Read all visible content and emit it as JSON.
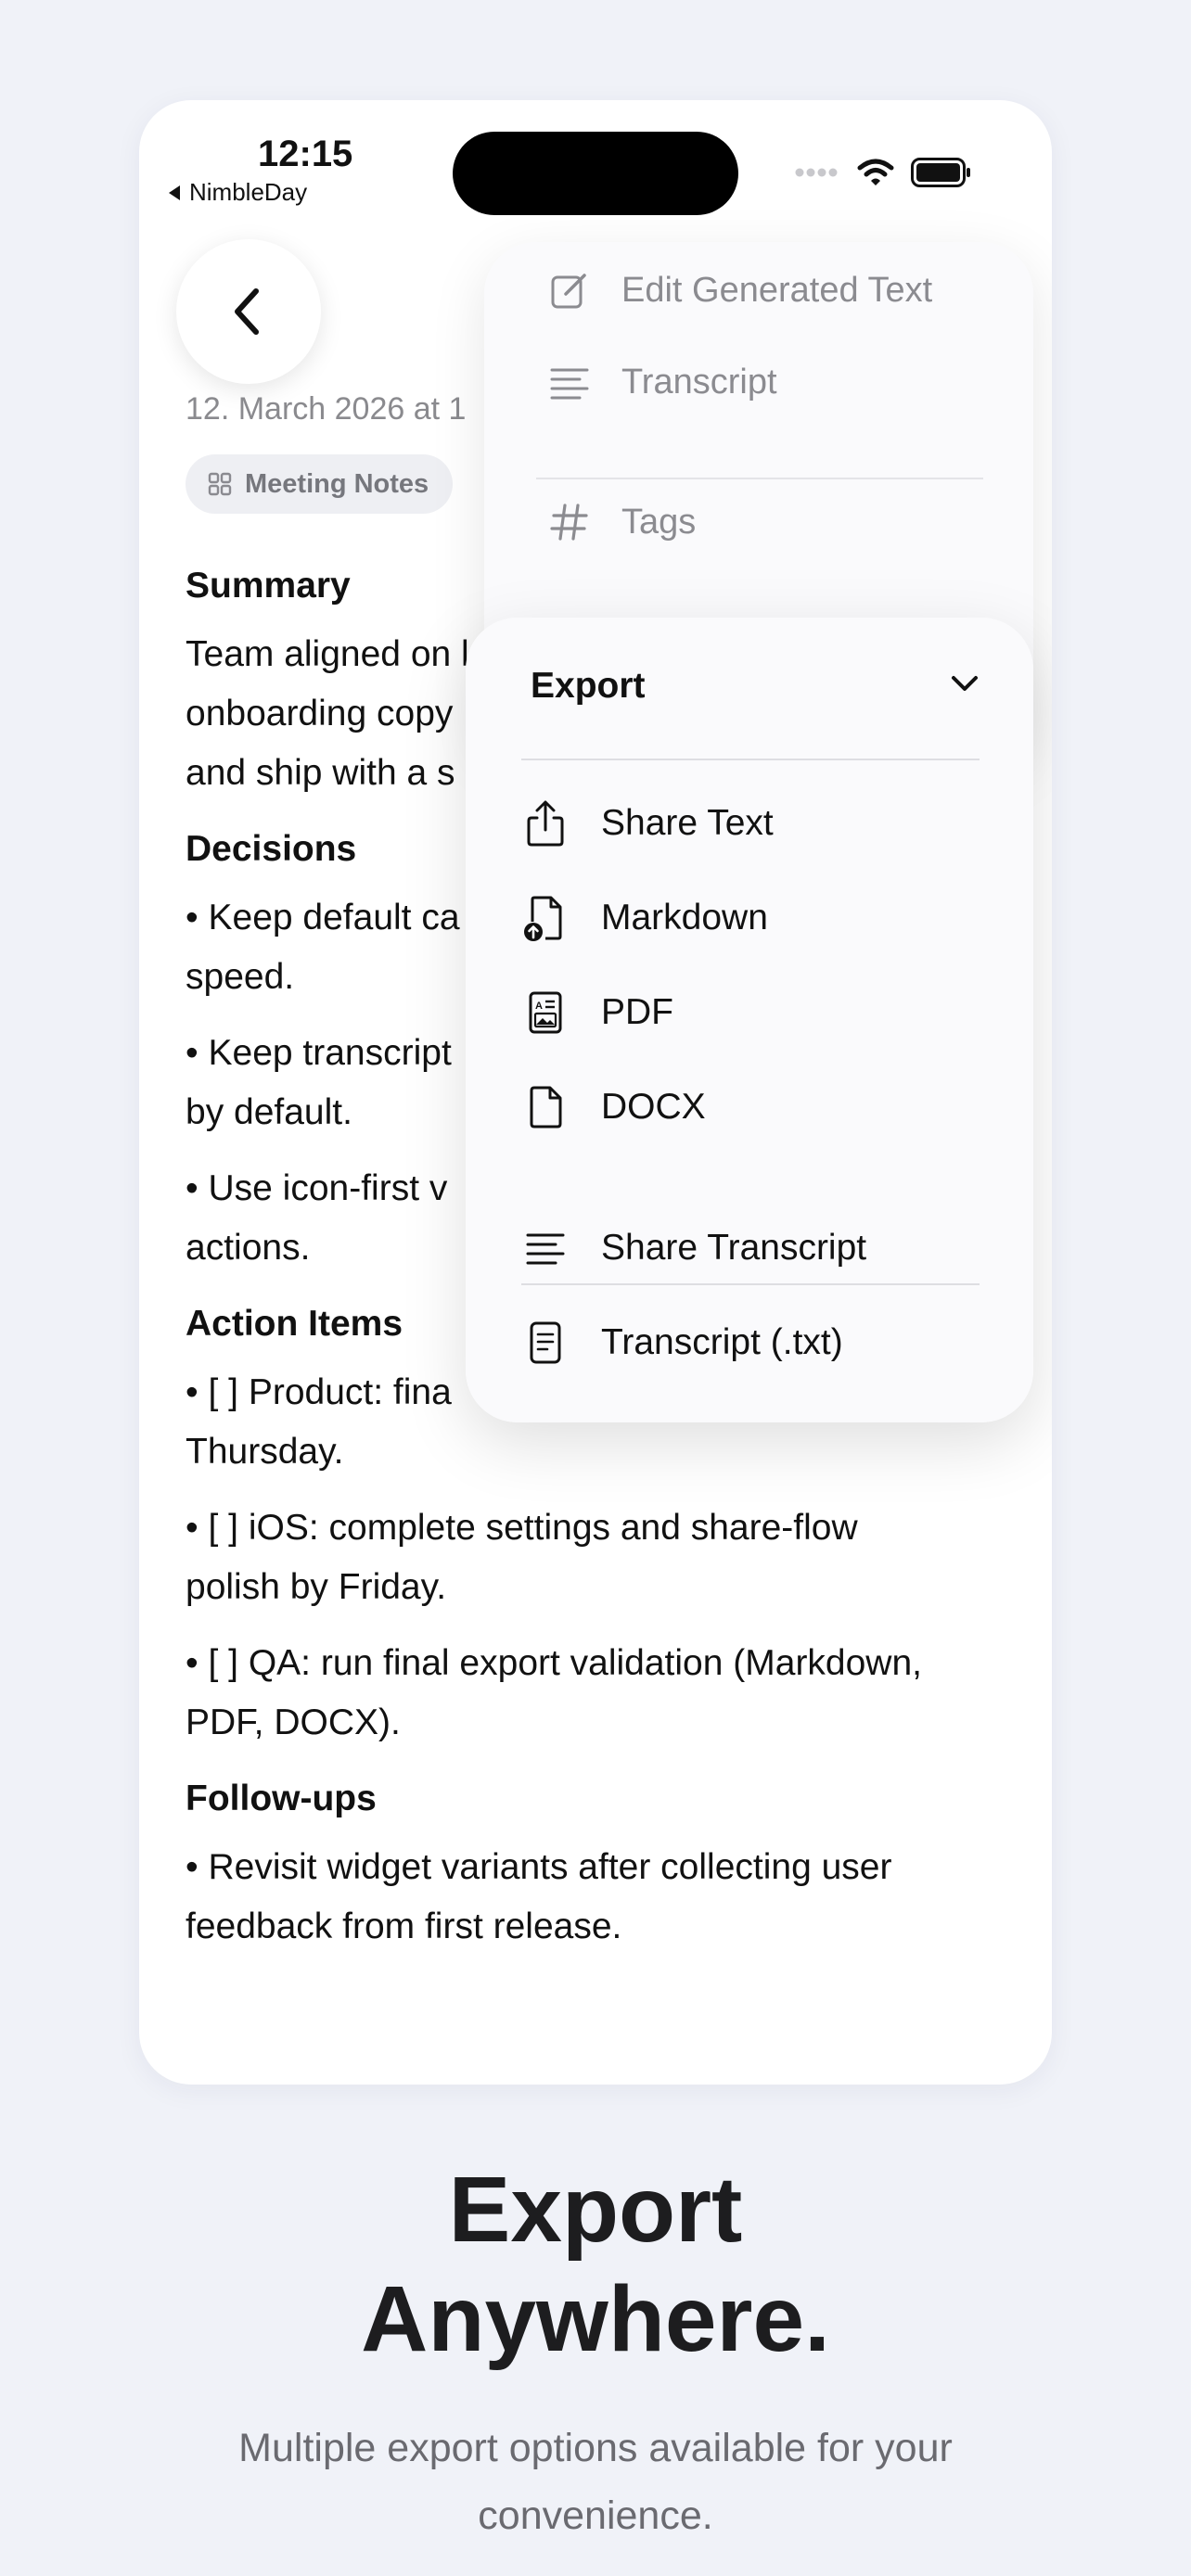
{
  "status_bar": {
    "time": "12:15",
    "back_app": "NimbleDay"
  },
  "note": {
    "date": "12. March 2026 at 1",
    "tag": "Meeting Notes",
    "sections": [
      {
        "heading": "Summary",
        "paragraphs": [
          "Team aligned on l\nonboarding copy\nand ship with a s"
        ]
      },
      {
        "heading": "Decisions",
        "paragraphs": [
          "• Keep default ca\nspeed.",
          "• Keep transcript\nby default.",
          "• Use icon-first v\nactions."
        ]
      },
      {
        "heading": "Action Items",
        "paragraphs": [
          "• [ ] Product: fina\nThursday.",
          "• [ ] iOS: complete settings and share-flow\npolish by Friday.",
          "• [ ] QA: run final export validation (Markdown,\nPDF, DOCX)."
        ]
      },
      {
        "heading": "Follow-ups",
        "paragraphs": [
          "• Revisit widget variants after collecting user\nfeedback from first release."
        ]
      }
    ]
  },
  "top_menu": {
    "edit_label": "Edit Generated Text",
    "transcript_label": "Transcript",
    "tags_label": "Tags"
  },
  "export_menu": {
    "title": "Export",
    "share_text": "Share Text",
    "markdown": "Markdown",
    "pdf": "PDF",
    "docx": "DOCX",
    "share_transcript": "Share Transcript",
    "transcript_txt": "Transcript (.txt)"
  },
  "promo": {
    "title_line1": "Export",
    "title_line2": "Anywhere.",
    "subtitle_line1": "Multiple export options available for your",
    "subtitle_line2": "convenience."
  },
  "colors": {
    "background": "#f0f2f8",
    "text": "#111111",
    "muted": "#8a8a8e"
  }
}
